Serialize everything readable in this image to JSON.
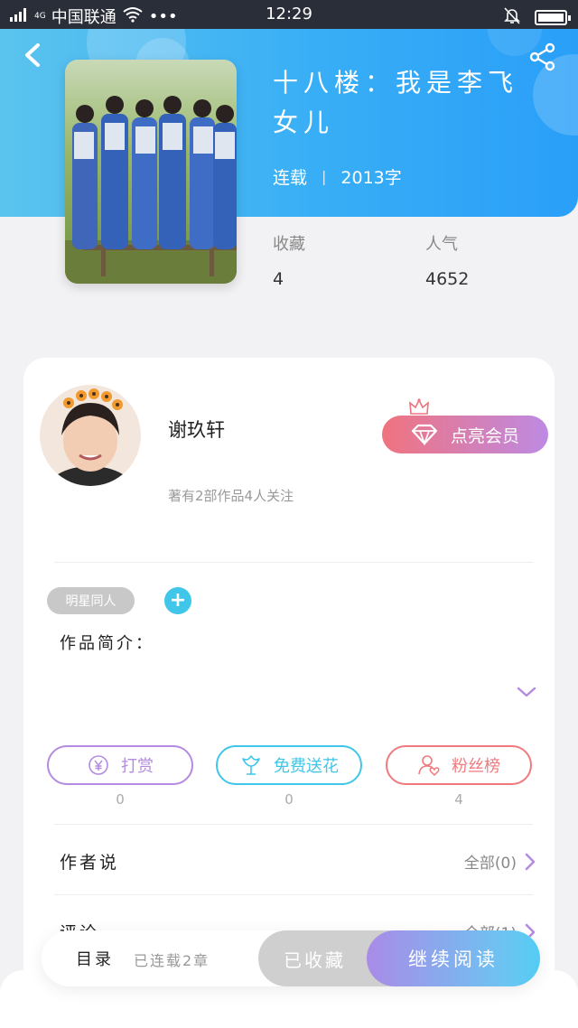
{
  "status_bar": {
    "network_label": "4G",
    "carrier": "中国联通",
    "more": "•••",
    "time": "12:29",
    "battery_percent": 100
  },
  "book": {
    "title": "十八楼：我是李飞女儿",
    "status": "连载",
    "separator": "|",
    "word_count": "2013字",
    "stats": [
      {
        "label": "收藏",
        "value": "4"
      },
      {
        "label": "人气",
        "value": "4652"
      }
    ]
  },
  "author": {
    "name": "谢玖轩",
    "description": "著有2部作品4人关注",
    "vip_button": "点亮会员"
  },
  "tags": [
    "明星同人"
  ],
  "add_tag": "+",
  "intro_label": "作品简介：",
  "actions": [
    {
      "label": "打赏",
      "count": "0",
      "color": "#b48be0",
      "icon": "yen-coin-icon"
    },
    {
      "label": "免费送花",
      "count": "0",
      "color": "#3fc6e8",
      "icon": "flower-icon"
    },
    {
      "label": "粉丝榜",
      "count": "4",
      "color": "#ef7a7e",
      "icon": "fans-icon"
    }
  ],
  "rows": [
    {
      "label": "作者说",
      "value": "全部(0)"
    },
    {
      "label": "评论",
      "value": "全部(1)"
    }
  ],
  "bottom_bar": {
    "toc": "目录",
    "updates": "已连载2章",
    "collected": "已收藏",
    "continue_reading": "继续阅读"
  },
  "colors": {
    "hero_start": "#5bc4ee",
    "hero_end": "#2a9ff8",
    "accent_purple": "#b48be0",
    "accent_cyan": "#3fc6e8",
    "accent_red": "#ef7a7e"
  }
}
